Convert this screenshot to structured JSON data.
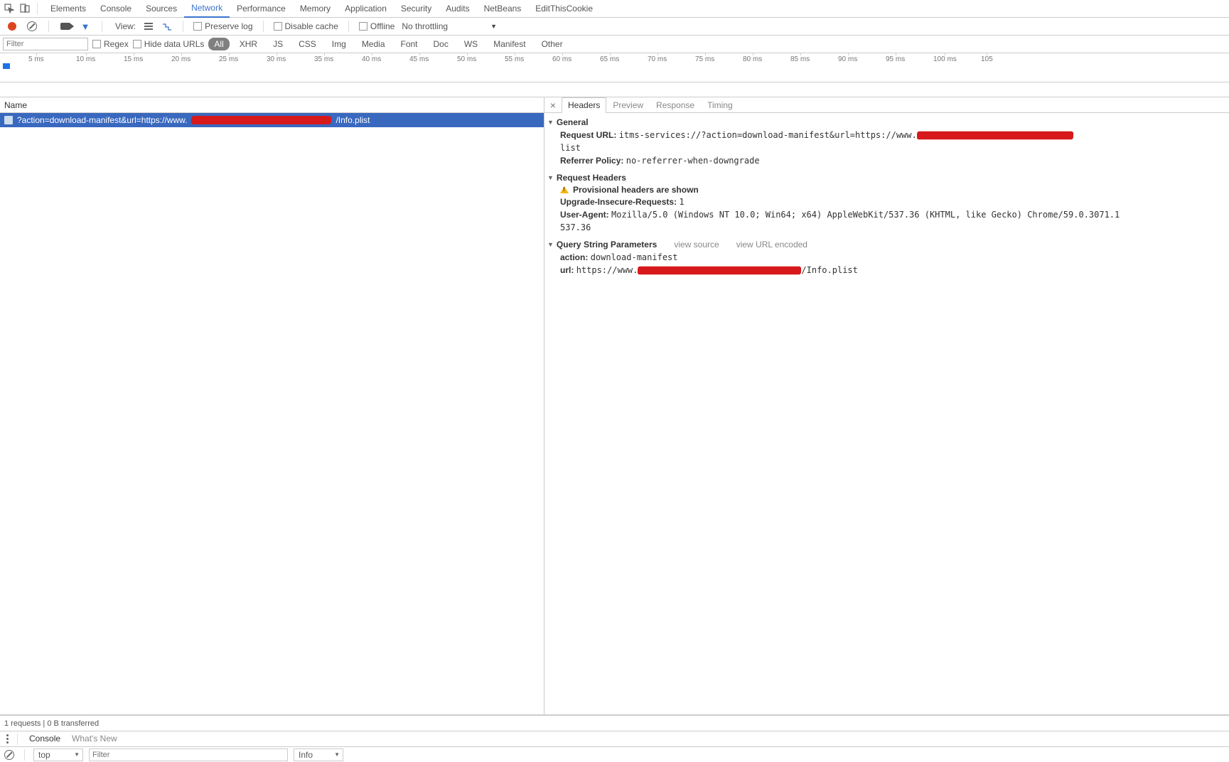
{
  "tabs": {
    "items": [
      "Elements",
      "Console",
      "Sources",
      "Network",
      "Performance",
      "Memory",
      "Application",
      "Security",
      "Audits",
      "NetBeans",
      "EditThisCookie"
    ],
    "active": 3
  },
  "toolbar": {
    "view_label": "View:",
    "preserve_log": "Preserve log",
    "disable_cache": "Disable cache",
    "offline": "Offline",
    "throttling": "No throttling"
  },
  "filterbar": {
    "filter_placeholder": "Filter",
    "regex": "Regex",
    "hide_data_urls": "Hide data URLs",
    "types": [
      "All",
      "XHR",
      "JS",
      "CSS",
      "Img",
      "Media",
      "Font",
      "Doc",
      "WS",
      "Manifest",
      "Other"
    ],
    "active_type": 0
  },
  "timeline": {
    "marks": [
      "5 ms",
      "10 ms",
      "15 ms",
      "20 ms",
      "25 ms",
      "30 ms",
      "35 ms",
      "40 ms",
      "45 ms",
      "50 ms",
      "55 ms",
      "60 ms",
      "65 ms",
      "70 ms",
      "75 ms",
      "80 ms",
      "85 ms",
      "90 ms",
      "95 ms",
      "100 ms",
      "105"
    ]
  },
  "requests": {
    "header": "Name",
    "row0_prefix": "?action=download-manifest&url=https://www.",
    "row0_suffix": "/Info.plist"
  },
  "detail": {
    "tabs": [
      "Headers",
      "Preview",
      "Response",
      "Timing"
    ],
    "active": 0,
    "general": {
      "title": "General",
      "request_url_label": "Request URL:",
      "request_url_prefix": "itms-services://?action=download-manifest&url=https://www.",
      "request_url_suffix": "list",
      "referrer_label": "Referrer Policy:",
      "referrer_value": "no-referrer-when-downgrade"
    },
    "req_headers": {
      "title": "Request Headers",
      "prov_warning": "Provisional headers are shown",
      "uir_label": "Upgrade-Insecure-Requests:",
      "uir_value": "1",
      "ua_label": "User-Agent:",
      "ua_value": "Mozilla/5.0 (Windows NT 10.0; Win64; x64) AppleWebKit/537.36 (KHTML, like Gecko) Chrome/59.0.3071.1",
      "ua_value2": "537.36"
    },
    "qs": {
      "title": "Query String Parameters",
      "view_source": "view source",
      "view_url_enc": "view URL encoded",
      "action_label": "action:",
      "action_value": "download-manifest",
      "url_label": "url:",
      "url_prefix": "https://www.",
      "url_suffix": "/Info.plist"
    }
  },
  "status": {
    "text": "1 requests | 0 B transferred"
  },
  "bottom_drawer": {
    "tabs": [
      "Console",
      "What's New"
    ],
    "top_selector": "top",
    "filter_placeholder": "Filter",
    "level_selector": "Info"
  }
}
